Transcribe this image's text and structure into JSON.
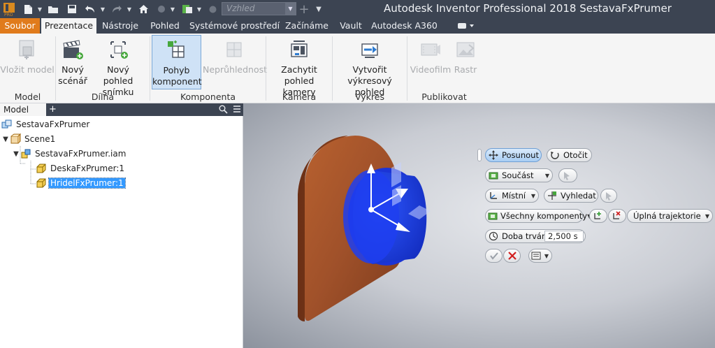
{
  "app": {
    "title": "Autodesk Inventor Professional 2018   SestavaFxPrumer",
    "view_combo": "Vzhled"
  },
  "tabs": [
    {
      "label": "Soubor"
    },
    {
      "label": "Prezentace"
    },
    {
      "label": "Nástroje"
    },
    {
      "label": "Pohled"
    },
    {
      "label": "Systémové prostředí"
    },
    {
      "label": "Začínáme"
    },
    {
      "label": "Vault"
    },
    {
      "label": "Autodesk A360"
    }
  ],
  "ribbon": {
    "vlozit_model": "Vložit model",
    "novy_scenar_1": "Nový",
    "novy_scenar_2": "scénář",
    "novy_pohled_1": "Nový",
    "novy_pohled_2": "pohled snímku",
    "pohyb_1": "Pohyb",
    "pohyb_2": "komponent",
    "nepruhlednost": "Neprůhlednost",
    "zachytit_1": "Zachytit",
    "zachytit_2": "pohled kamery",
    "vytvorit_1": "Vytvořit",
    "vytvorit_2": "výkresový pohled",
    "videofilm": "Videofilm",
    "rastr": "Rastr",
    "groups": {
      "model": "Model",
      "dilna": "Dílna",
      "komponenta": "Komponenta",
      "kamera": "Kamera",
      "vykres": "Výkres",
      "publikovat": "Publikovat"
    }
  },
  "browser": {
    "tab": "Model",
    "tree": {
      "root": "SestavaFxPrumer",
      "scene": "Scene1",
      "assembly": "SestavaFxPrumer.iam",
      "part1": "DeskaFxPrumer:1",
      "part2": "HridelFxPrumer:1"
    }
  },
  "minitoolbar": {
    "posunout": "Posunout",
    "otocit": "Otočit",
    "soucast": "Součást",
    "mistni": "Místní",
    "vyhledat": "Vyhledat",
    "vsechny_komponenty": "Všechny komponenty",
    "trajektorie": "Úplná trajektorie",
    "doba_trvani": "Doba trvání",
    "duration_value": "2,500 s"
  },
  "colors": {
    "titlebar": "#3c4452",
    "file_tab": "#e07b1c",
    "selection": "#3399ff",
    "shaft": "#1f3fe0",
    "plate": "#a6532a"
  }
}
